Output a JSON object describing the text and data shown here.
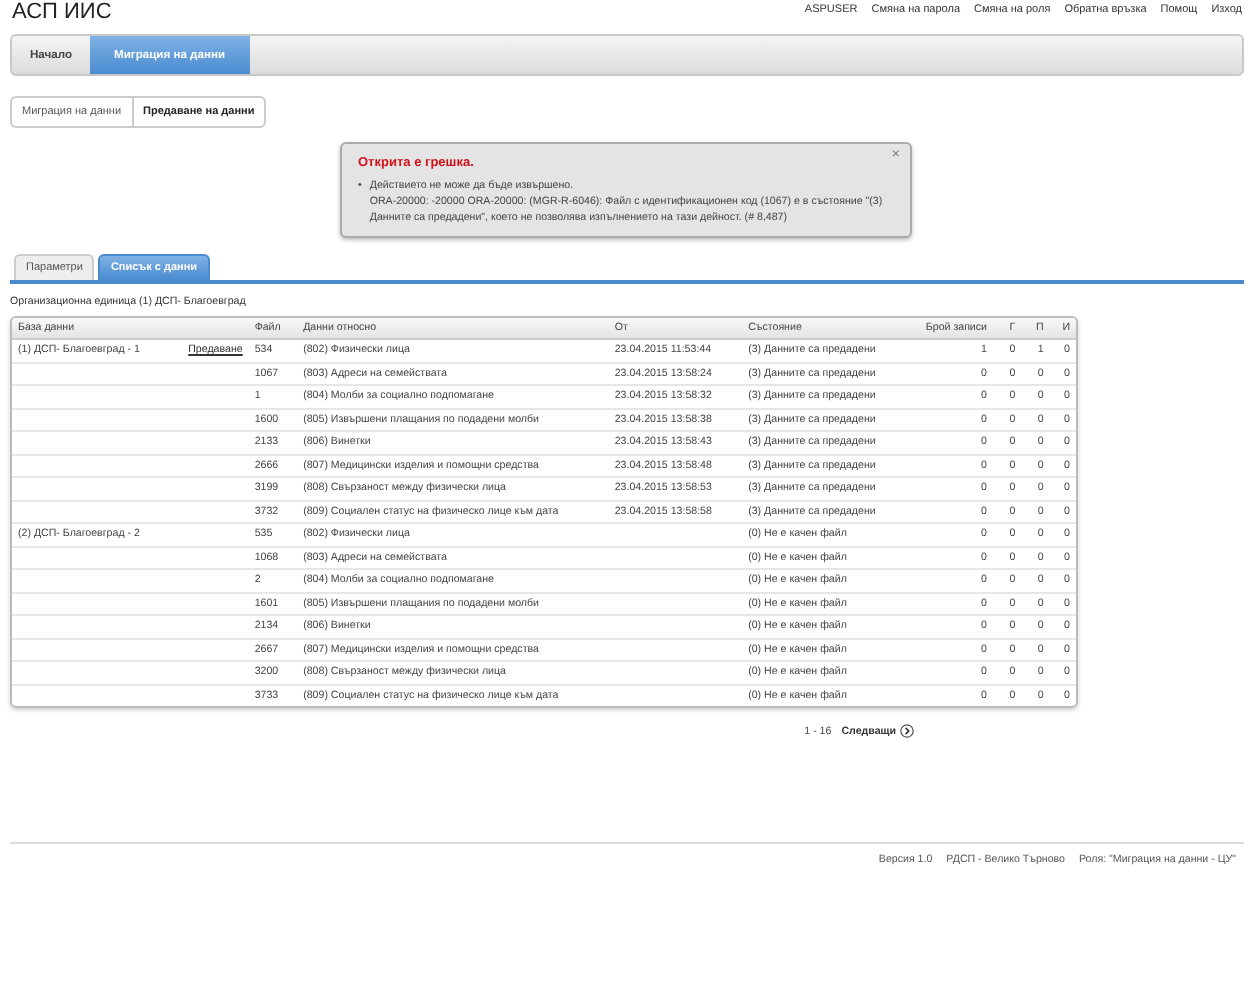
{
  "app_title": "АСП ИИС",
  "user_links": [
    "ASPUSER",
    "Смяна на парола",
    "Смяна на роля",
    "Обратна връзка",
    "Помощ",
    "Изход"
  ],
  "nav_tabs": [
    {
      "label": "Начало",
      "selected": false
    },
    {
      "label": "Миграция на данни",
      "selected": true
    }
  ],
  "breadcrumbs": [
    "Миграция на данни",
    "Предаване на данни"
  ],
  "error": {
    "title": "Открита е грешка.",
    "close": "×",
    "bullet": "•",
    "message": "Действието не може да бъде извършено.",
    "detail": "ORA-20000: -20000 ORA-20000: (MGR-R-6046): Файл с идентификационен код (1067) е в състояние \"(3) Данните са предадени\", което не позволява изпълнението на тази дейност. (# 8,487)"
  },
  "tabs": [
    {
      "label": "Параметри",
      "selected": false
    },
    {
      "label": "Списък с данни",
      "selected": true
    }
  ],
  "org_unit": "Организационна единица (1) ДСП- Благоевград",
  "table": {
    "columns": [
      "База данни",
      "Файл",
      "Данни относно",
      "От",
      "Състояние",
      "Брой записи",
      "Г",
      "П",
      "И"
    ],
    "rows": [
      {
        "database": "(1) ДСП- Благоевград - 1",
        "action": "Предаване",
        "file": "534",
        "data": "(802) Физически лица",
        "from": "23.04.2015 11:53:44",
        "state": "(3) Данните са предадени",
        "records": "1",
        "g": "0",
        "p": "1",
        "i": "0"
      },
      {
        "file": "1067",
        "data": "(803) Адреси на семействата",
        "from": "23.04.2015 13:58:24",
        "state": "(3) Данните са предадени",
        "records": "0",
        "g": "0",
        "p": "0",
        "i": "0"
      },
      {
        "file": "1",
        "data": "(804) Молби за социално подпомагане",
        "from": "23.04.2015 13:58:32",
        "state": "(3) Данните са предадени",
        "records": "0",
        "g": "0",
        "p": "0",
        "i": "0"
      },
      {
        "file": "1600",
        "data": "(805) Извършени плащания по подадени молби",
        "from": "23.04.2015 13:58:38",
        "state": "(3) Данните са предадени",
        "records": "0",
        "g": "0",
        "p": "0",
        "i": "0"
      },
      {
        "file": "2133",
        "data": "(806) Винетки",
        "from": "23.04.2015 13:58:43",
        "state": "(3) Данните са предадени",
        "records": "0",
        "g": "0",
        "p": "0",
        "i": "0"
      },
      {
        "file": "2666",
        "data": "(807) Медицински изделия и помощни средства",
        "from": "23.04.2015 13:58:48",
        "state": "(3) Данните са предадени",
        "records": "0",
        "g": "0",
        "p": "0",
        "i": "0"
      },
      {
        "file": "3199",
        "data": "(808) Свързаност между физически лица",
        "from": "23.04.2015 13:58:53",
        "state": "(3) Данните са предадени",
        "records": "0",
        "g": "0",
        "p": "0",
        "i": "0"
      },
      {
        "file": "3732",
        "data": "(809) Социален статус на физическо лице към дата",
        "from": "23.04.2015 13:58:58",
        "state": "(3) Данните са предадени",
        "records": "0",
        "g": "0",
        "p": "0",
        "i": "0"
      },
      {
        "database": "(2) ДСП- Благоевград - 2",
        "file": "535",
        "data": "(802) Физически лица",
        "state": "(0) Не е качен файл",
        "records": "0",
        "g": "0",
        "p": "0",
        "i": "0"
      },
      {
        "file": "1068",
        "data": "(803) Адреси на семействата",
        "state": "(0) Не е качен файл",
        "records": "0",
        "g": "0",
        "p": "0",
        "i": "0"
      },
      {
        "file": "2",
        "data": "(804) Молби за социално подпомагане",
        "state": "(0) Не е качен файл",
        "records": "0",
        "g": "0",
        "p": "0",
        "i": "0"
      },
      {
        "file": "1601",
        "data": "(805) Извършени плащания по подадени молби",
        "state": "(0) Не е качен файл",
        "records": "0",
        "g": "0",
        "p": "0",
        "i": "0"
      },
      {
        "file": "2134",
        "data": "(806) Винетки",
        "state": "(0) Не е качен файл",
        "records": "0",
        "g": "0",
        "p": "0",
        "i": "0"
      },
      {
        "file": "2667",
        "data": "(807) Медицински изделия и помощни средства",
        "state": "(0) Не е качен файл",
        "records": "0",
        "g": "0",
        "p": "0",
        "i": "0"
      },
      {
        "file": "3200",
        "data": "(808) Свързаност между физически лица",
        "state": "(0) Не е качен файл",
        "records": "0",
        "g": "0",
        "p": "0",
        "i": "0"
      },
      {
        "file": "3733",
        "data": "(809) Социален статус на физическо лице към дата",
        "state": "(0) Не е качен файл",
        "records": "0",
        "g": "0",
        "p": "0",
        "i": "0"
      }
    ]
  },
  "pager": {
    "range": "1 - 16",
    "next": "Следващи"
  },
  "footer": [
    "Версия 1.0",
    "РДСП - Велико Търново",
    "Роля: \"Миграция на данни - ЦУ\""
  ]
}
